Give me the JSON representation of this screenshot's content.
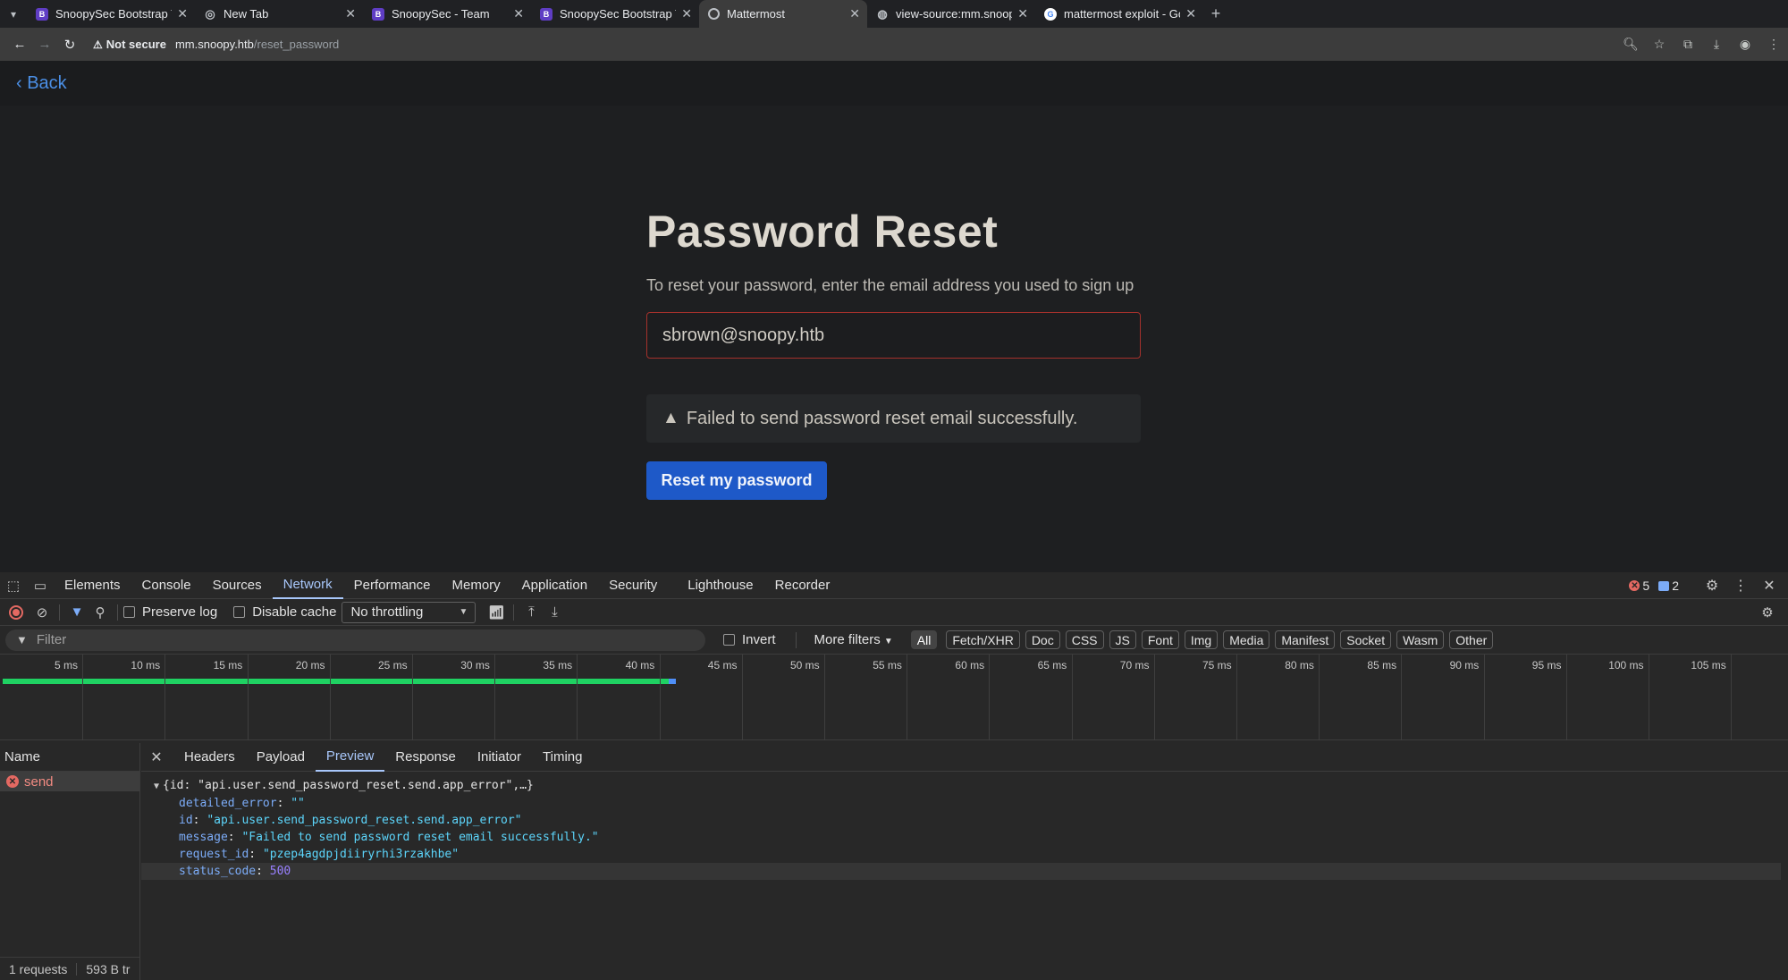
{
  "browser": {
    "tabs": [
      {
        "label": "SnoopySec Bootstrap T",
        "favicon": "bootstrap-icon",
        "active": false
      },
      {
        "label": "New Tab",
        "favicon": "chrome-icon",
        "active": false
      },
      {
        "label": "SnoopySec - Team",
        "favicon": "bootstrap-icon",
        "active": false
      },
      {
        "label": "SnoopySec Bootstrap T",
        "favicon": "bootstrap-icon",
        "active": false
      },
      {
        "label": "Mattermost",
        "favicon": "mattermost-icon",
        "active": true
      },
      {
        "label": "view-source:mm.snoop",
        "favicon": "globe-icon",
        "active": false
      },
      {
        "label": "mattermost exploit - Go",
        "favicon": "google-icon",
        "active": false
      }
    ],
    "security_label": "Not secure",
    "url_host": "mm.snoopy.htb",
    "url_path": "/reset_password"
  },
  "page": {
    "back_label": "Back",
    "title": "Password Reset",
    "subtitle": "To reset your password, enter the email address you used to sign up",
    "email_value": "sbrown@snoopy.htb",
    "error_message": "Failed to send password reset email successfully.",
    "reset_button": "Reset my password"
  },
  "devtools": {
    "tabs": [
      "Elements",
      "Console",
      "Sources",
      "Network",
      "Performance",
      "Memory",
      "Application",
      "Security",
      "Lighthouse",
      "Recorder"
    ],
    "active_tab": "Network",
    "error_count": "5",
    "message_count": "2",
    "preserve_log": "Preserve log",
    "disable_cache": "Disable cache",
    "throttling": "No throttling",
    "filter_placeholder": "Filter",
    "invert": "Invert",
    "more_filters": "More filters",
    "filter_chips": [
      "All",
      "Fetch/XHR",
      "Doc",
      "CSS",
      "JS",
      "Font",
      "Img",
      "Media",
      "Manifest",
      "Socket",
      "Wasm",
      "Other"
    ],
    "active_chip": "All",
    "timeline_ticks": [
      "5 ms",
      "10 ms",
      "15 ms",
      "20 ms",
      "25 ms",
      "30 ms",
      "35 ms",
      "40 ms",
      "45 ms",
      "50 ms",
      "55 ms",
      "60 ms",
      "65 ms",
      "70 ms",
      "75 ms",
      "80 ms",
      "85 ms",
      "90 ms",
      "95 ms",
      "100 ms",
      "105 ms"
    ],
    "request_end_ms": 41,
    "name_header": "Name",
    "requests": [
      {
        "name": "send",
        "status": "error"
      }
    ],
    "status_requests": "1 requests",
    "status_transferred": "593 B tr",
    "detail_tabs": [
      "Headers",
      "Payload",
      "Preview",
      "Response",
      "Initiator",
      "Timing"
    ],
    "active_detail_tab": "Preview",
    "preview": {
      "summary": "{id: \"api.user.send_password_reset.send.app_error\",…}",
      "fields": [
        {
          "key": "detailed_error",
          "value": "\"\"",
          "type": "string"
        },
        {
          "key": "id",
          "value": "\"api.user.send_password_reset.send.app_error\"",
          "type": "string"
        },
        {
          "key": "message",
          "value": "\"Failed to send password reset email successfully.\"",
          "type": "string"
        },
        {
          "key": "request_id",
          "value": "\"pzep4agdpjdiiryrhi3rzakhbe\"",
          "type": "string"
        },
        {
          "key": "status_code",
          "value": "500",
          "type": "number"
        }
      ]
    }
  }
}
